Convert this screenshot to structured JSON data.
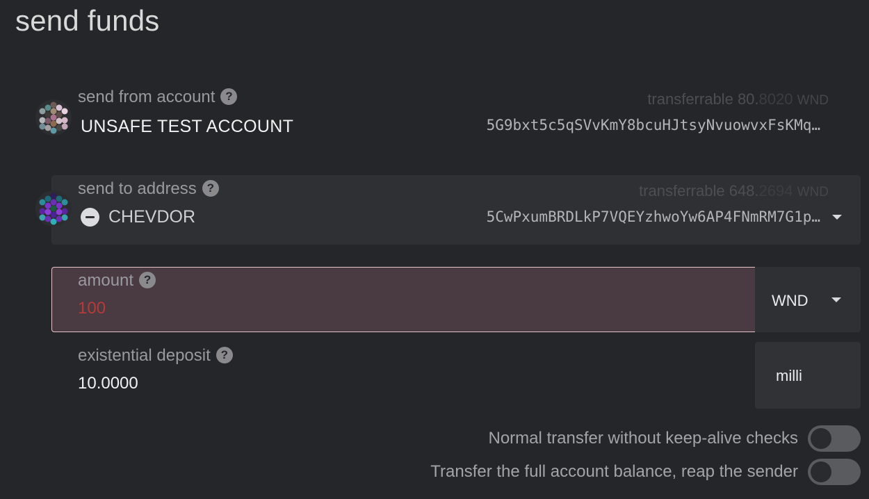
{
  "title": "send funds",
  "from": {
    "label": "send from account",
    "help": "?",
    "name": "UNSAFE TEST ACCOUNT",
    "balance_label": "transferrable",
    "balance_int": "80.",
    "balance_frac": "8020",
    "balance_unit": "WND",
    "address": "5G9bxt5c5qSVvKmY8bcuHJtsyNvuowvxFsKMq…"
  },
  "to": {
    "label": "send to address",
    "help": "?",
    "name": "CHEVDOR",
    "balance_label": "transferrable",
    "balance_int": "648.",
    "balance_frac": "2694",
    "balance_unit": "WND",
    "address": "5CwPxumBRDLkP7VQEYzhwoYw6AP4FNmRM7G1p…"
  },
  "amount": {
    "label": "amount",
    "help": "?",
    "value": "100",
    "unit": "WND",
    "menu_option": "milli"
  },
  "existential": {
    "label": "existential deposit",
    "help": "?",
    "value": "10.0000"
  },
  "toggles": [
    {
      "label": "Normal transfer without keep-alive checks",
      "on": false
    },
    {
      "label": "Transfer the full account balance, reap the sender",
      "on": false
    }
  ],
  "colors": {
    "background": "#25262a",
    "panel": "#2f3034",
    "error_bg": "#4a3b42",
    "error_text": "#b53a3a"
  }
}
